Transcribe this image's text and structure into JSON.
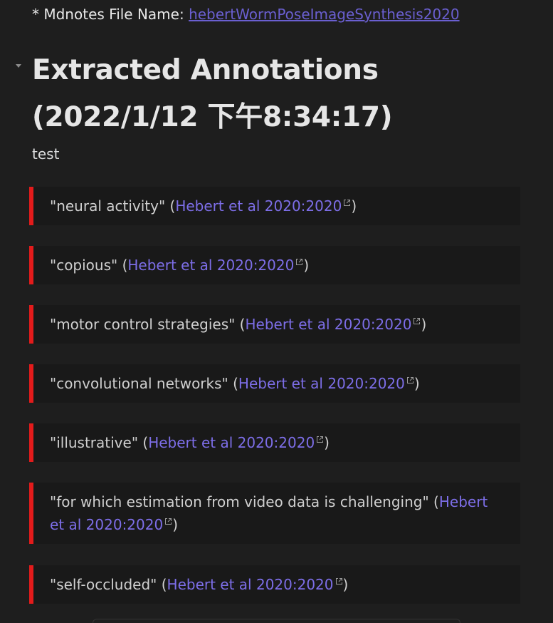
{
  "meta": {
    "prefix": "* Mdnotes File Name: ",
    "file_link": "hebertWormPoseImageSynthesis2020"
  },
  "heading": {
    "line1": "Extracted Annotations",
    "line2": "(2022/1/12 下午8:34:17)"
  },
  "paragraph": "test",
  "annotations": [
    {
      "quote": "\"neural activity\" (",
      "cite": "Hebert et al 2020:2020",
      "close": ")"
    },
    {
      "quote": "\"copious\" (",
      "cite": "Hebert et al 2020:2020",
      "close": ")"
    },
    {
      "quote": "\"motor control strategies\" (",
      "cite": "Hebert et al 2020:2020",
      "close": ")"
    },
    {
      "quote": "\"convolutional networks\" (",
      "cite": "Hebert et al 2020:2020",
      "close": ")"
    },
    {
      "quote": "\"illustrative\" (",
      "cite": "Hebert et al 2020:2020",
      "close": ")"
    },
    {
      "quote": "\"for which estimation from video data is challenging\" (",
      "cite": "Hebert et al 2020:2020",
      "close": ")"
    },
    {
      "quote": "\"self-occluded\" (",
      "cite": "Hebert et al 2020:2020",
      "close": ")"
    }
  ],
  "colors": {
    "background": "#1e1e1e",
    "blockquote_border": "#e31b1b",
    "link": "#7d6ee8"
  },
  "icons": {
    "external_link": "external-link-icon",
    "fold": "fold-arrow-icon"
  }
}
